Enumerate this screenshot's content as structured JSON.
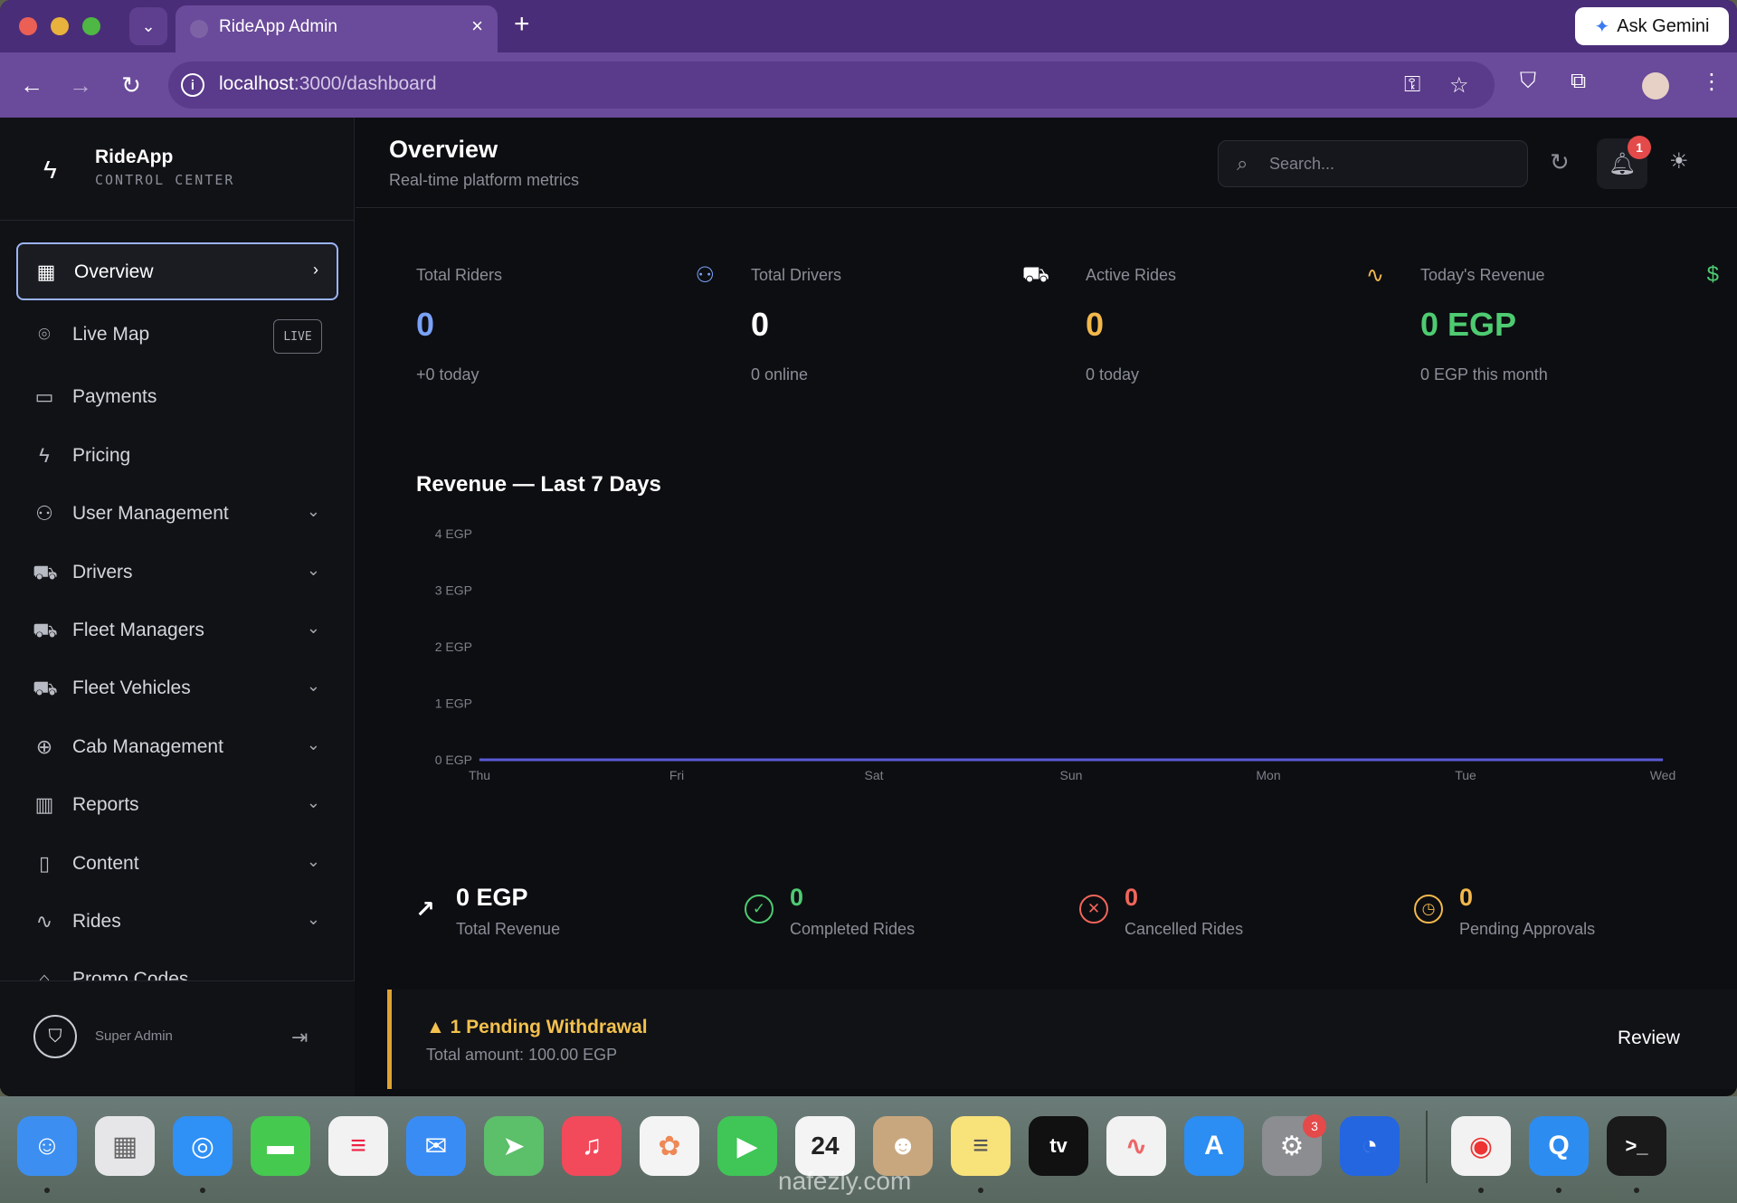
{
  "browser": {
    "tab_title": "RideApp Admin",
    "url_host": "localhost",
    "url_path": ":3000/dashboard",
    "gemini_label": "Ask Gemini"
  },
  "brand": {
    "name": "RideApp",
    "subtitle": "CONTROL CENTER"
  },
  "sidebar": {
    "items": [
      {
        "label": "Overview"
      },
      {
        "label": "Live Map",
        "badge": "LIVE"
      },
      {
        "label": "Payments"
      },
      {
        "label": "Pricing"
      },
      {
        "label": "User Management"
      },
      {
        "label": "Drivers"
      },
      {
        "label": "Fleet Managers"
      },
      {
        "label": "Fleet Vehicles"
      },
      {
        "label": "Cab Management"
      },
      {
        "label": "Reports"
      },
      {
        "label": "Content"
      },
      {
        "label": "Rides"
      },
      {
        "label": "Promo Codes"
      }
    ],
    "footer_role": "Super Admin"
  },
  "header": {
    "title": "Overview",
    "subtitle": "Real-time platform metrics",
    "search_placeholder": "Search...",
    "notification_count": "1"
  },
  "stats": [
    {
      "label": "Total Riders",
      "value": "0",
      "sub": "+0 today",
      "color": "#7aa2f7"
    },
    {
      "label": "Total Drivers",
      "value": "0",
      "sub": "0 online",
      "color": "#ffffff"
    },
    {
      "label": "Active Rides",
      "value": "0",
      "sub": "0 today",
      "color": "#f2b84b"
    },
    {
      "label": "Today's Revenue",
      "value": "0 EGP",
      "sub": "0 EGP this month",
      "color": "#4ecb71"
    }
  ],
  "chart_data": {
    "type": "line",
    "title": "Revenue — Last 7 Days",
    "categories": [
      "Thu",
      "Fri",
      "Sat",
      "Sun",
      "Mon",
      "Tue",
      "Wed"
    ],
    "values": [
      0,
      0,
      0,
      0,
      0,
      0,
      0
    ],
    "yticks": [
      "0 EGP",
      "1 EGP",
      "2 EGP",
      "3 EGP",
      "4 EGP"
    ],
    "ylim": [
      0,
      4
    ],
    "line_color": "#5b5bd6",
    "grid": false
  },
  "summary": [
    {
      "value": "0 EGP",
      "label": "Total Revenue",
      "color": "#ffffff"
    },
    {
      "value": "0",
      "label": "Completed Rides",
      "color": "#4ecb71"
    },
    {
      "value": "0",
      "label": "Cancelled Rides",
      "color": "#f0665a"
    },
    {
      "value": "0",
      "label": "Pending Approvals",
      "color": "#f2b84b"
    }
  ],
  "alert": {
    "title": "1 Pending Withdrawal",
    "subtitle": "Total amount: 100.00 EGP",
    "action": "Review"
  },
  "dock": {
    "calendar_day": "24",
    "settings_badge": "3",
    "watermark": "nafezly.com"
  }
}
